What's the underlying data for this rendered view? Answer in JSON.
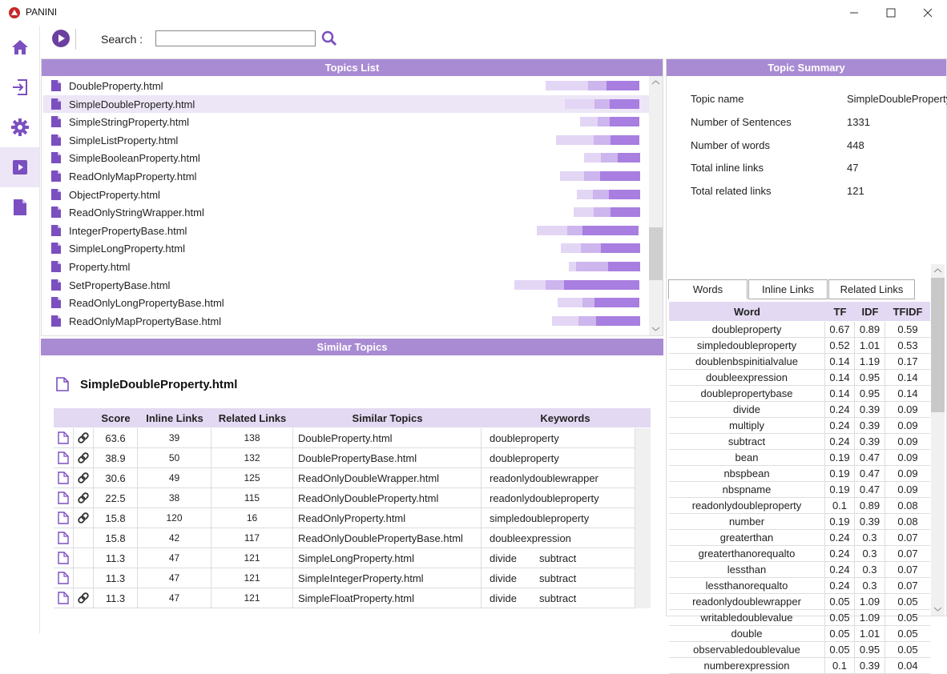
{
  "window": {
    "title": "PANINI",
    "minimize": "—",
    "maximize": "☐",
    "close": "✕"
  },
  "toolbar": {
    "search_label": "Search :",
    "search_value": ""
  },
  "topics_list": {
    "header": "Topics List",
    "items": [
      {
        "name": "DoubleProperty.html",
        "bars": [
          0.45,
          0.2,
          0.35
        ]
      },
      {
        "name": "SimpleDoubleProperty.html",
        "bars": [
          0.4,
          0.2,
          0.4
        ]
      },
      {
        "name": "SimpleStringProperty.html",
        "bars": [
          0.3,
          0.2,
          0.5
        ]
      },
      {
        "name": "SimpleListProperty.html",
        "bars": [
          0.45,
          0.2,
          0.35
        ]
      },
      {
        "name": "SimpleBooleanProperty.html",
        "bars": [
          0.3,
          0.3,
          0.4
        ]
      },
      {
        "name": "ReadOnlyMapProperty.html",
        "bars": [
          0.3,
          0.2,
          0.5
        ]
      },
      {
        "name": "ObjectProperty.html",
        "bars": [
          0.25,
          0.25,
          0.5
        ]
      },
      {
        "name": "ReadOnlyStringWrapper.html",
        "bars": [
          0.3,
          0.25,
          0.45
        ]
      },
      {
        "name": "IntegerPropertyBase.html",
        "bars": [
          0.3,
          0.15,
          0.55
        ]
      },
      {
        "name": "SimpleLongProperty.html",
        "bars": [
          0.25,
          0.25,
          0.5
        ]
      },
      {
        "name": "Property.html",
        "bars": [
          0.1,
          0.45,
          0.45
        ]
      },
      {
        "name": "SetPropertyBase.html",
        "bars": [
          0.25,
          0.15,
          0.6
        ]
      },
      {
        "name": "ReadOnlyLongPropertyBase.html",
        "bars": [
          0.3,
          0.15,
          0.55
        ]
      },
      {
        "name": "ReadOnlyMapPropertyBase.html",
        "bars": [
          0.3,
          0.2,
          0.5
        ]
      }
    ],
    "selected_index": 1
  },
  "similar": {
    "header": "Similar Topics",
    "topic_title": "SimpleDoubleProperty.html",
    "columns": [
      "Score",
      "Inline Links",
      "Related Links",
      "Similar Topics",
      "Keywords"
    ],
    "rows": [
      {
        "link": true,
        "score": "63.6",
        "inline": "39",
        "related": "138",
        "topic": "DoubleProperty.html",
        "kw1": "doubleproperty",
        "kw2": ""
      },
      {
        "link": true,
        "score": "38.9",
        "inline": "50",
        "related": "132",
        "topic": "DoublePropertyBase.html",
        "kw1": "doubleproperty",
        "kw2": ""
      },
      {
        "link": true,
        "score": "30.6",
        "inline": "49",
        "related": "125",
        "topic": "ReadOnlyDoubleWrapper.html",
        "kw1": "readonlydoublewrapper",
        "kw2": ""
      },
      {
        "link": true,
        "score": "22.5",
        "inline": "38",
        "related": "115",
        "topic": "ReadOnlyDoubleProperty.html",
        "kw1": "readonlydoubleproperty",
        "kw2": ""
      },
      {
        "link": true,
        "score": "15.8",
        "inline": "120",
        "related": "16",
        "topic": "ReadOnlyProperty.html",
        "kw1": "simpledoubleproperty",
        "kw2": ""
      },
      {
        "link": false,
        "score": "15.8",
        "inline": "42",
        "related": "117",
        "topic": "ReadOnlyDoublePropertyBase.html",
        "kw1": "doubleexpression",
        "kw2": ""
      },
      {
        "link": false,
        "score": "11.3",
        "inline": "47",
        "related": "121",
        "topic": "SimpleLongProperty.html",
        "kw1": "divide",
        "kw2": "subtract"
      },
      {
        "link": false,
        "score": "11.3",
        "inline": "47",
        "related": "121",
        "topic": "SimpleIntegerProperty.html",
        "kw1": "divide",
        "kw2": "subtract"
      },
      {
        "link": true,
        "score": "11.3",
        "inline": "47",
        "related": "121",
        "topic": "SimpleFloatProperty.html",
        "kw1": "divide",
        "kw2": "subtract"
      }
    ]
  },
  "summary": {
    "header": "Topic Summary",
    "fields": [
      {
        "label": "Topic name",
        "value": "SimpleDoubleProperty.html"
      },
      {
        "label": "Number of Sentences",
        "value": "1331"
      },
      {
        "label": "Number of words",
        "value": "448"
      },
      {
        "label": "Total inline links",
        "value": "47"
      },
      {
        "label": "Total related links",
        "value": "121"
      }
    ],
    "tabs": [
      "Words",
      "Inline Links",
      "Related Links"
    ],
    "active_tab": "Words",
    "word_columns": [
      "Word",
      "TF",
      "IDF",
      "TFIDF"
    ],
    "words": [
      [
        "doubleproperty",
        "0.67",
        "0.89",
        "0.59"
      ],
      [
        "simpledoubleproperty",
        "0.52",
        "1.01",
        "0.53"
      ],
      [
        "doublenbspinitialvalue",
        "0.14",
        "1.19",
        "0.17"
      ],
      [
        "doubleexpression",
        "0.14",
        "0.95",
        "0.14"
      ],
      [
        "doublepropertybase",
        "0.14",
        "0.95",
        "0.14"
      ],
      [
        "divide",
        "0.24",
        "0.39",
        "0.09"
      ],
      [
        "multiply",
        "0.24",
        "0.39",
        "0.09"
      ],
      [
        "subtract",
        "0.24",
        "0.39",
        "0.09"
      ],
      [
        "bean",
        "0.19",
        "0.47",
        "0.09"
      ],
      [
        "nbspbean",
        "0.19",
        "0.47",
        "0.09"
      ],
      [
        "nbspname",
        "0.19",
        "0.47",
        "0.09"
      ],
      [
        "readonlydoubleproperty",
        "0.1",
        "0.89",
        "0.08"
      ],
      [
        "number",
        "0.19",
        "0.39",
        "0.08"
      ],
      [
        "greaterthan",
        "0.24",
        "0.3",
        "0.07"
      ],
      [
        "greaterthanorequalto",
        "0.24",
        "0.3",
        "0.07"
      ],
      [
        "lessthan",
        "0.24",
        "0.3",
        "0.07"
      ],
      [
        "lessthanorequalto",
        "0.24",
        "0.3",
        "0.07"
      ],
      [
        "readonlydoublewrapper",
        "0.05",
        "1.09",
        "0.05"
      ],
      [
        "writabledoublevalue",
        "0.05",
        "1.09",
        "0.05"
      ],
      [
        "double",
        "0.05",
        "1.01",
        "0.05"
      ],
      [
        "observabledoublevalue",
        "0.05",
        "0.95",
        "0.05"
      ],
      [
        "numberexpression",
        "0.1",
        "0.39",
        "0.04"
      ]
    ]
  },
  "colors": {
    "accent": "#a98bd4",
    "bar_light": "#e3d6f5",
    "bar_mid": "#cdb5ee",
    "bar_dark": "#a87ee0",
    "icon": "#7b4fc0"
  }
}
